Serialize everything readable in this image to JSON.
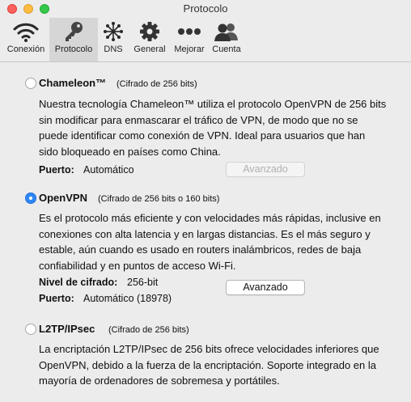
{
  "window": {
    "title": "Protocolo"
  },
  "toolbar": {
    "items": [
      {
        "label": "Conexión",
        "icon": "wifi-icon",
        "selected": false
      },
      {
        "label": "Protocolo",
        "icon": "key-icon",
        "selected": true
      },
      {
        "label": "DNS",
        "icon": "dns-network-icon",
        "selected": false
      },
      {
        "label": "General",
        "icon": "gear-icon",
        "selected": false
      },
      {
        "label": "Mejorar",
        "icon": "more-dots-icon",
        "selected": false
      },
      {
        "label": "Cuenta",
        "icon": "account-icon",
        "selected": false
      }
    ]
  },
  "options": {
    "chameleon": {
      "title": "Chameleon™",
      "subtitle": "(Cifrado de 256 bits)",
      "selected": false,
      "description": "Nuestra tecnología Chameleon™ utiliza el protocolo OpenVPN de 256 bits sin modificar para enmascarar el tráfico de VPN, de modo que no se puede identificar como conexión de VPN. Ideal para usuarios que han sido bloqueado en países como China.",
      "port_label": "Puerto:",
      "port_value": "Automático",
      "advanced_button": "Avanzado",
      "advanced_enabled": false
    },
    "openvpn": {
      "title": "OpenVPN",
      "subtitle": "(Cifrado de 256 bits o 160 bits)",
      "selected": true,
      "description": "Es el protocolo más eficiente y con velocidades más rápidas, inclusive en conexiones con alta latencia y en largas distancias. Es el más seguro y estable, aún cuando es usado en routers inalámbricos, redes de baja confiabilidad y en puntos de acceso Wi-Fi.",
      "encryption_label": "Nivel de cifrado:",
      "encryption_value": "256-bit",
      "port_label": "Puerto:",
      "port_value": "Automático (18978)",
      "advanced_button": "Avanzado",
      "advanced_enabled": true
    },
    "l2tp": {
      "title": "L2TP/IPsec",
      "subtitle": "(Cifrado de 256 bits)",
      "selected": false,
      "description": "La encriptación L2TP/IPsec de 256 bits ofrece velocidades inferiores que OpenVPN, debido a la fuerza de la encriptación. Soporte integrado en la mayoría de ordenadores de sobremesa y portátiles."
    }
  },
  "colors": {
    "accent": "#2f87f5",
    "selected_tab": "#d6d6d6",
    "background": "#ececec"
  }
}
